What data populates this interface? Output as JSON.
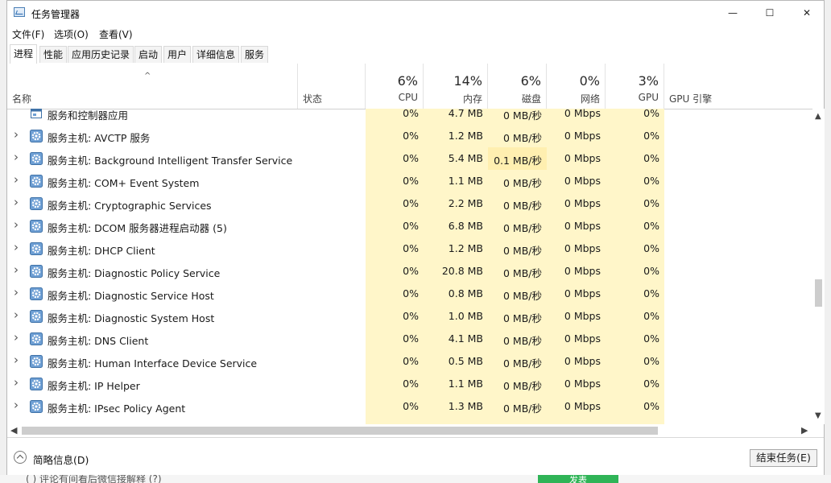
{
  "window": {
    "title": "任务管理器",
    "minimize": "—",
    "maximize": "☐",
    "close": "✕"
  },
  "menu": [
    "文件(F)",
    "选项(O)",
    "查看(V)"
  ],
  "tabs": [
    "进程",
    "性能",
    "应用历史记录",
    "启动",
    "用户",
    "详细信息",
    "服务"
  ],
  "active_tab": "进程",
  "columns": {
    "name": "名称",
    "status": "状态",
    "cpu": {
      "pct": "6%",
      "label": "CPU"
    },
    "memory": {
      "pct": "14%",
      "label": "内存"
    },
    "disk": {
      "pct": "6%",
      "label": "磁盘"
    },
    "network": {
      "pct": "0%",
      "label": "网络"
    },
    "gpu": {
      "pct": "3%",
      "label": "GPU"
    },
    "gpu_engine": "GPU 引擎"
  },
  "colors": {
    "band": "#fff6c9",
    "band_hot": "#ffefb0",
    "button_green": "#2fb457"
  },
  "rows": [
    {
      "name": "服务和控制器应用",
      "cpu": "0%",
      "mem": "4.7 MB",
      "disk": "0 MB/秒",
      "net": "0 Mbps",
      "gpu": "0%",
      "expandable": false,
      "icon": "app-window-icon"
    },
    {
      "name": "服务主机: AVCTP 服务",
      "cpu": "0%",
      "mem": "1.2 MB",
      "disk": "0 MB/秒",
      "net": "0 Mbps",
      "gpu": "0%",
      "expandable": true,
      "icon": "gear-icon"
    },
    {
      "name": "服务主机: Background Intelligent Transfer Service",
      "cpu": "0%",
      "mem": "5.4 MB",
      "disk": "0.1 MB/秒",
      "net": "0 Mbps",
      "gpu": "0%",
      "expandable": true,
      "icon": "gear-icon",
      "disk_hot": true
    },
    {
      "name": "服务主机: COM+ Event System",
      "cpu": "0%",
      "mem": "1.1 MB",
      "disk": "0 MB/秒",
      "net": "0 Mbps",
      "gpu": "0%",
      "expandable": true,
      "icon": "gear-icon"
    },
    {
      "name": "服务主机: Cryptographic Services",
      "cpu": "0%",
      "mem": "2.2 MB",
      "disk": "0 MB/秒",
      "net": "0 Mbps",
      "gpu": "0%",
      "expandable": true,
      "icon": "gear-icon"
    },
    {
      "name": "服务主机: DCOM 服务器进程启动器 (5)",
      "cpu": "0%",
      "mem": "6.8 MB",
      "disk": "0 MB/秒",
      "net": "0 Mbps",
      "gpu": "0%",
      "expandable": true,
      "icon": "gear-icon"
    },
    {
      "name": "服务主机: DHCP Client",
      "cpu": "0%",
      "mem": "1.2 MB",
      "disk": "0 MB/秒",
      "net": "0 Mbps",
      "gpu": "0%",
      "expandable": true,
      "icon": "gear-icon"
    },
    {
      "name": "服务主机: Diagnostic Policy Service",
      "cpu": "0%",
      "mem": "20.8 MB",
      "disk": "0 MB/秒",
      "net": "0 Mbps",
      "gpu": "0%",
      "expandable": true,
      "icon": "gear-icon"
    },
    {
      "name": "服务主机: Diagnostic Service Host",
      "cpu": "0%",
      "mem": "0.8 MB",
      "disk": "0 MB/秒",
      "net": "0 Mbps",
      "gpu": "0%",
      "expandable": true,
      "icon": "gear-icon"
    },
    {
      "name": "服务主机: Diagnostic System Host",
      "cpu": "0%",
      "mem": "1.0 MB",
      "disk": "0 MB/秒",
      "net": "0 Mbps",
      "gpu": "0%",
      "expandable": true,
      "icon": "gear-icon"
    },
    {
      "name": "服务主机: DNS Client",
      "cpu": "0%",
      "mem": "4.1 MB",
      "disk": "0 MB/秒",
      "net": "0 Mbps",
      "gpu": "0%",
      "expandable": true,
      "icon": "gear-icon"
    },
    {
      "name": "服务主机: Human Interface Device Service",
      "cpu": "0%",
      "mem": "0.5 MB",
      "disk": "0 MB/秒",
      "net": "0 Mbps",
      "gpu": "0%",
      "expandable": true,
      "icon": "gear-icon"
    },
    {
      "name": "服务主机: IP Helper",
      "cpu": "0%",
      "mem": "1.1 MB",
      "disk": "0 MB/秒",
      "net": "0 Mbps",
      "gpu": "0%",
      "expandable": true,
      "icon": "gear-icon"
    },
    {
      "name": "服务主机: IPsec Policy Agent",
      "cpu": "0%",
      "mem": "1.3 MB",
      "disk": "0 MB/秒",
      "net": "0 Mbps",
      "gpu": "0%",
      "expandable": true,
      "icon": "gear-icon"
    }
  ],
  "footer": {
    "brief": "简略信息(D)",
    "end_task": "结束任务(E)"
  },
  "underlay": {
    "text": "( ) 评论有间看后微信接解释 (?)",
    "button": "发表"
  }
}
